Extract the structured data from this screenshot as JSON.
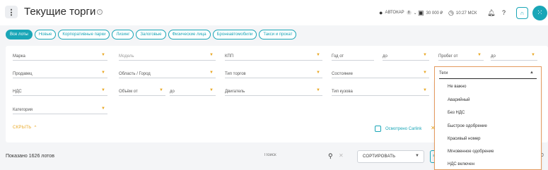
{
  "header": {
    "title": "Текущие торги",
    "account": "АВТОКАР",
    "account_badge": "8",
    "balance": "30 000 ₽",
    "time": "10:27 МСК"
  },
  "tabs": [
    {
      "label": "Все лоты",
      "active": true
    },
    {
      "label": "Новые",
      "active": false
    },
    {
      "label": "Корпоративные парки",
      "active": false
    },
    {
      "label": "Лизинг",
      "active": false
    },
    {
      "label": "Залоговые",
      "active": false
    },
    {
      "label": "Физические лица",
      "active": false
    },
    {
      "label": "Бронеавтомобили",
      "active": false
    },
    {
      "label": "Такси и прокат",
      "active": false
    }
  ],
  "filters": {
    "brand": "Марка",
    "model": "Модель",
    "gearbox": "КПП",
    "year_from": "Год от",
    "year_to": "до",
    "mileage_from": "Пробег от",
    "mileage_to": "до",
    "seller": "Продавец",
    "region": "Область / Город",
    "auction_type": "Тип торгов",
    "condition": "Состояние",
    "vat": "НДС",
    "volume_from": "Объём от",
    "volume_to": "до",
    "engine": "Двигатель",
    "body_type": "Тип кузова",
    "category": "Категория",
    "collapse_label": "СКРЫТЬ",
    "carlink_label": "Осмотрено Carlink"
  },
  "tags_dropdown": {
    "label": "Теги",
    "options": [
      "Не важно",
      "Аварийный",
      "Без НДС",
      "Быстрое одобрение",
      "Красивый номер",
      "Мгновенное одобрение",
      "НДС включен"
    ]
  },
  "results": {
    "count_text": "Показано 1626 лотов",
    "search_placeholder": "Поиск",
    "sort_label": "СОРТИРОВАТЬ",
    "page_size": "30"
  },
  "colors": {
    "accent": "#1aa6b7",
    "warning": "#e9a825",
    "dropdown_border": "#e49a5e"
  }
}
